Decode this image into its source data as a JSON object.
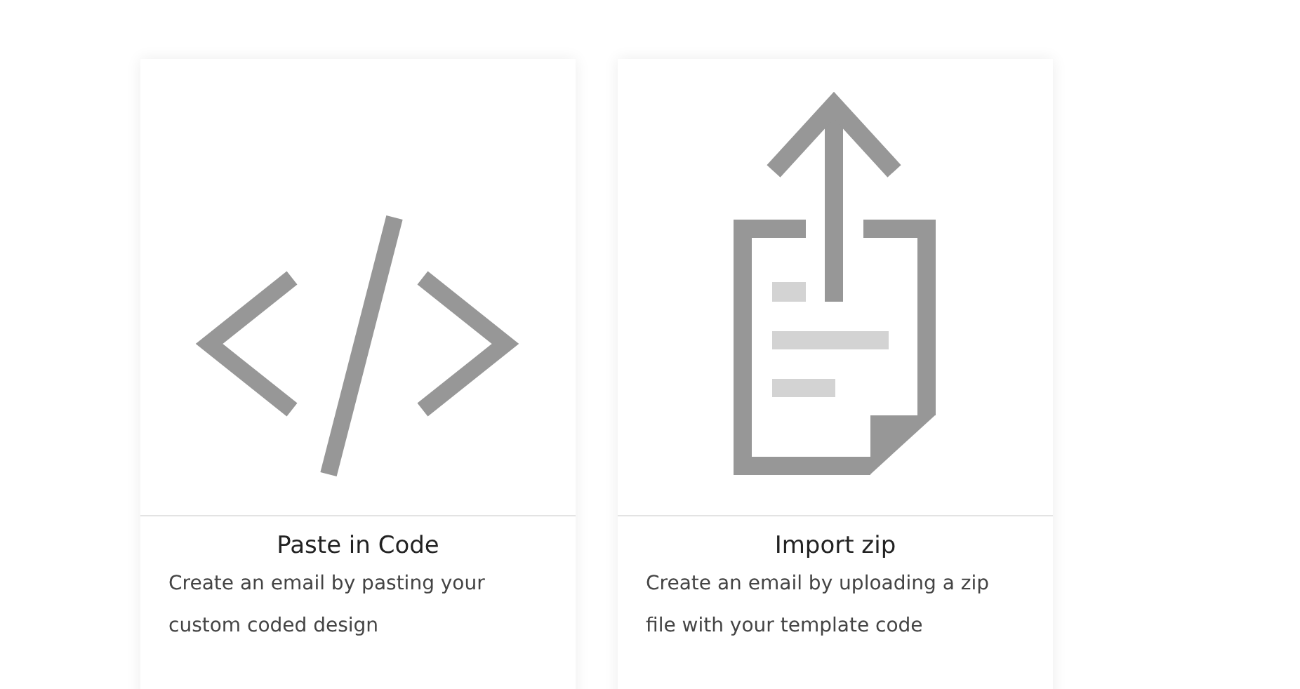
{
  "cards": [
    {
      "kind": "code",
      "title": "Paste in Code",
      "description": "Create an email by pasting your custom coded design"
    },
    {
      "kind": "zip",
      "title": "Import zip",
      "description": "Create an email by uploading a zip file with your template code"
    }
  ]
}
